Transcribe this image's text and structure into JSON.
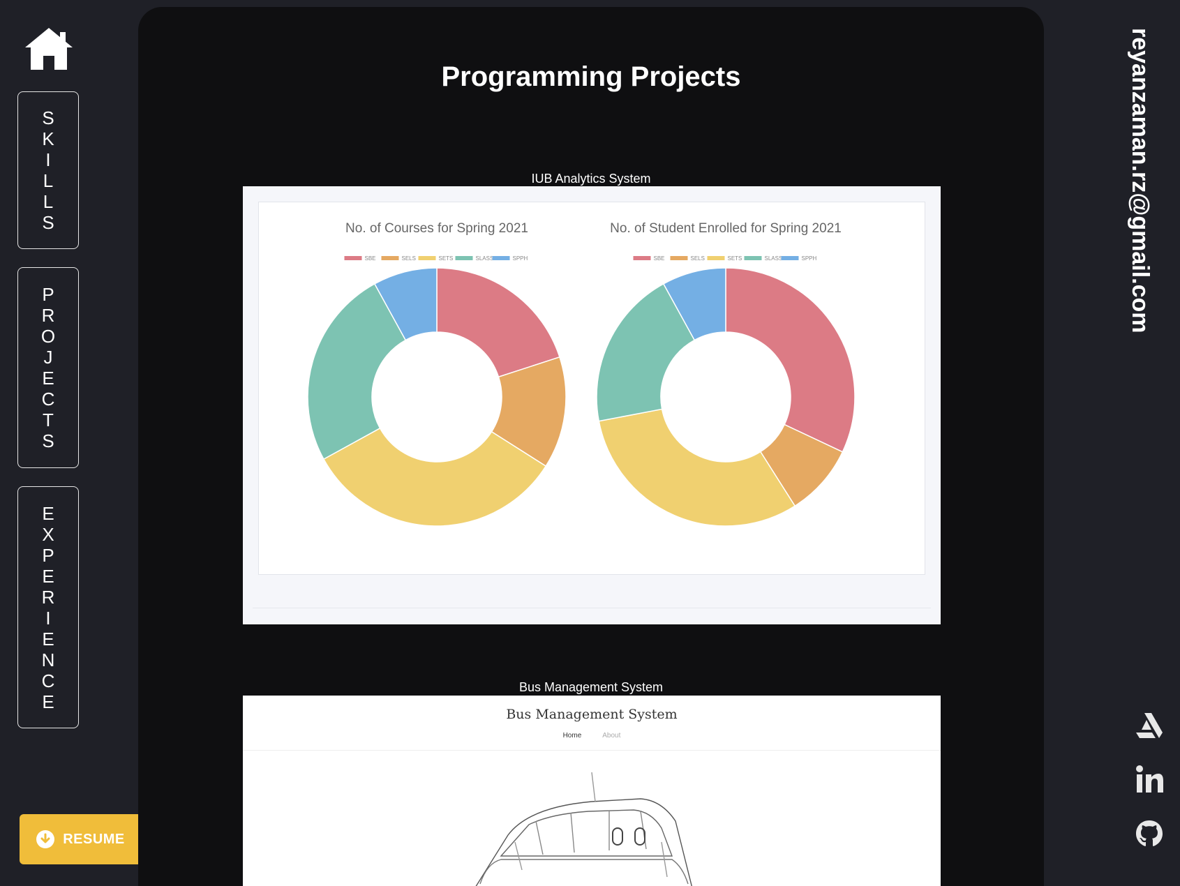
{
  "nav": {
    "home_icon": "home-icon",
    "items": [
      {
        "label": "SKILLS",
        "letters": [
          "S",
          "K",
          "I",
          "L",
          "L",
          "S"
        ]
      },
      {
        "label": "PROJECTS",
        "letters": [
          "P",
          "R",
          "O",
          "J",
          "E",
          "C",
          "T",
          "S"
        ]
      },
      {
        "label": "EXPERIENCE",
        "letters": [
          "E",
          "X",
          "P",
          "E",
          "R",
          "I",
          "E",
          "N",
          "C",
          "E"
        ]
      }
    ]
  },
  "resume": {
    "label": "RESUME",
    "icon": "download-icon"
  },
  "main": {
    "title": "Programming Projects",
    "projects": [
      {
        "caption": "IUB Analytics System"
      },
      {
        "caption": "Bus Management System"
      }
    ]
  },
  "bus_app": {
    "title": "Bus Management System",
    "nav": [
      "Home",
      "About"
    ]
  },
  "contact": {
    "email": "reyanzaman.rz@gmail.com"
  },
  "social": [
    "artstation-icon",
    "linkedin-icon",
    "github-icon"
  ],
  "colors": {
    "accent": "#f0bd3a",
    "sidebar": "#1f2027",
    "panel": "#0f0f11"
  },
  "chart_data": [
    {
      "type": "pie",
      "title": "No. of Courses for Spring 2021",
      "legend": [
        "SBE",
        "SELS",
        "SETS",
        "SLASS",
        "SPPH"
      ],
      "legend_position": "top",
      "values": [
        20,
        14,
        33,
        25,
        8
      ],
      "colors": [
        "#dc7b85",
        "#e5a962",
        "#f0d070",
        "#7dc3b2",
        "#74afe4"
      ]
    },
    {
      "type": "pie",
      "title": "No. of Student Enrolled for Spring 2021",
      "legend": [
        "SBE",
        "SELS",
        "SETS",
        "SLASS",
        "SPPH"
      ],
      "legend_position": "top",
      "values": [
        32,
        9,
        31,
        20,
        8
      ],
      "colors": [
        "#dc7b85",
        "#e5a962",
        "#f0d070",
        "#7dc3b2",
        "#74afe4"
      ]
    }
  ]
}
